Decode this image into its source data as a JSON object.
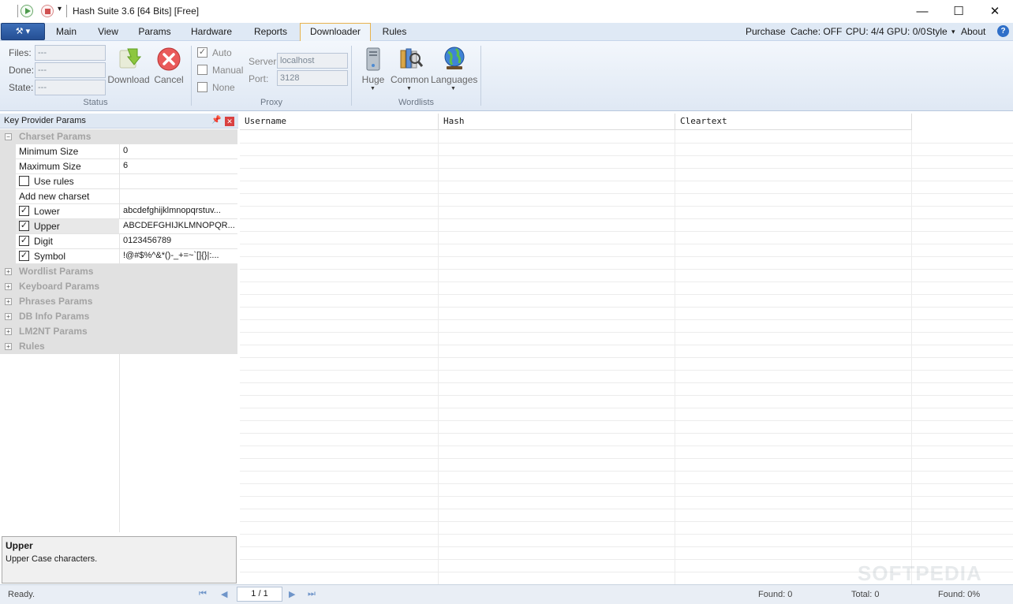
{
  "window": {
    "title": "Hash Suite 3.6 [64 Bits] [Free]",
    "quick_access_menu": "▾",
    "minimize": "—",
    "maximize": "☐",
    "close": "✕"
  },
  "ribbon": {
    "app_button": "⚒ ▾",
    "tabs": [
      "Main",
      "View",
      "Params",
      "Hardware",
      "Reports",
      "Downloader",
      "Rules"
    ],
    "active_tab": "Downloader",
    "right": {
      "purchase": "Purchase",
      "cache": "Cache: OFF",
      "cpu_gpu": "CPU: 4/4 GPU: 0/0",
      "style": "Style",
      "style_arrow": "▾",
      "about": "About",
      "help": "?"
    },
    "status_group": {
      "caption": "Status",
      "files_label": "Files:",
      "files_value": "---",
      "done_label": "Done:",
      "done_value": "---",
      "state_label": "State:",
      "state_value": "---",
      "download_label": "Download",
      "cancel_label": "Cancel"
    },
    "proxy_group": {
      "caption": "Proxy",
      "auto_label": "Auto",
      "auto_checked": "✓",
      "manual_label": "Manual",
      "none_label": "None",
      "server_label": "Server:",
      "server_value": "localhost",
      "port_label": "Port:",
      "port_value": "3128"
    },
    "wordlists_group": {
      "caption": "Wordlists",
      "huge_label": "Huge",
      "common_label": "Common",
      "languages_label": "Languages",
      "drop": "▼"
    }
  },
  "key_provider": {
    "title": "Key Provider Params",
    "pin": "📌",
    "close": "✕",
    "charset_category": "Charset Params",
    "collapse_sign": "−",
    "expand_sign": "+",
    "charset_rows": [
      {
        "key": "Minimum Size",
        "value": "0"
      },
      {
        "key": "Maximum Size",
        "value": "6"
      },
      {
        "key": "Use rules",
        "value": "",
        "checked": ""
      },
      {
        "key": "Add new charset",
        "value": ""
      },
      {
        "key": "Lower",
        "value": "abcdefghijklmnopqrstuv...",
        "checked": "✓"
      },
      {
        "key": "Upper",
        "value": "ABCDEFGHIJKLMNOPQR...",
        "checked": "✓"
      },
      {
        "key": "Digit",
        "value": "0123456789",
        "checked": "✓"
      },
      {
        "key": "Symbol",
        "value": " !@#$%^&*()-_+=~`[]{}|:...",
        "checked": "✓"
      }
    ],
    "collapsed_categories": [
      "Wordlist Params",
      "Keyboard Params",
      "Phrases Params",
      "DB Info Params",
      "LM2NT Params",
      "Rules"
    ],
    "description": {
      "title": "Upper",
      "text": "Upper Case characters."
    }
  },
  "grid": {
    "columns": [
      "Username",
      "Hash",
      "Cleartext"
    ],
    "rows": []
  },
  "statusbar": {
    "status": "Ready.",
    "first": "⏮",
    "prev": "◀",
    "page": "1 / 1",
    "next": "▶",
    "last": "⏭",
    "found": "Found: 0",
    "total": "Total: 0",
    "found_pct": "Found: 0%"
  },
  "watermark": "SOFTPEDIA"
}
